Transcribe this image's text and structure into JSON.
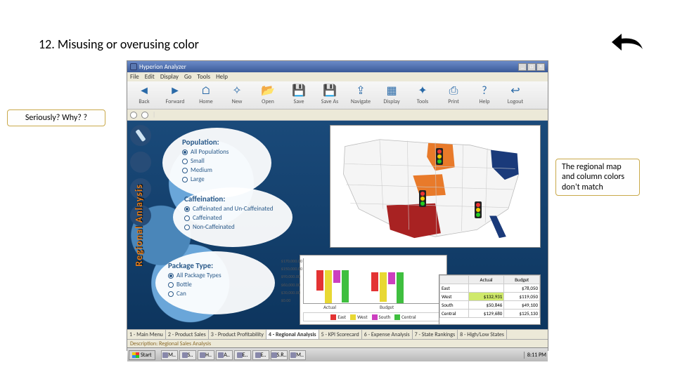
{
  "slide": {
    "title": "12.  Misusing or overusing color"
  },
  "callouts": {
    "left": "Seriously?  Why? ?",
    "right": "The regional map and column colors don't match"
  },
  "app": {
    "title": "Hyperion Analyzer",
    "menus": [
      "File",
      "Edit",
      "Display",
      "Go",
      "Tools",
      "Help"
    ],
    "toolbar": [
      {
        "label": "Back",
        "glyph": "◄"
      },
      {
        "label": "Forward",
        "glyph": "►"
      },
      {
        "label": "Home",
        "glyph": "⌂"
      },
      {
        "label": "New",
        "glyph": "✧"
      },
      {
        "label": "Open",
        "glyph": "📂"
      },
      {
        "label": "Save",
        "glyph": "💾"
      },
      {
        "label": "Save As",
        "glyph": "💾"
      },
      {
        "label": "Navigate",
        "glyph": "⇪"
      },
      {
        "label": "Display",
        "glyph": "▦"
      },
      {
        "label": "Tools",
        "glyph": "✦"
      },
      {
        "label": "Print",
        "glyph": "⎙"
      },
      {
        "label": "Help",
        "glyph": "?"
      },
      {
        "label": "Logout",
        "glyph": "↩"
      }
    ],
    "side_label": "Regional Anlaysis",
    "panels": {
      "population": {
        "title": "Population:",
        "options": [
          "All Populations",
          "Small",
          "Medium",
          "Large"
        ],
        "selected": 0
      },
      "caffeination": {
        "title": "Caffeination:",
        "options": [
          "Caffeinated and Un-Caffeinated",
          "Caffeinated",
          "Non-Caffeinated"
        ],
        "selected": 0
      },
      "package": {
        "title": "Package Type:",
        "options": [
          "All Package Types",
          "Bottle",
          "Can"
        ],
        "selected": 0
      }
    },
    "tabs": [
      "1 - Main Menu",
      "2 - Product Sales",
      "3 - Product Profitability",
      "4 - Regional Analysis",
      "5 - KPI Scorecard",
      "6 - Expense Analysis",
      "7 - State Rankings",
      "8 - High/Low States"
    ],
    "active_tab": 3,
    "description": "Description: Regional Sales Analysis",
    "taskbar": {
      "start": "Start",
      "items": [
        "M..",
        "S..",
        "H..",
        "A..",
        "E..",
        "E..",
        "S.R..",
        "M.."
      ],
      "time": "8:11 PM"
    }
  },
  "chart_data": {
    "type": "bar",
    "categories": [
      "Actual",
      "Budget"
    ],
    "series": [
      {
        "name": "East",
        "color": "#e33333",
        "values": [
          80000,
          78050
        ]
      },
      {
        "name": "West",
        "color": "#e8d833",
        "values": [
          132000,
          119050
        ]
      },
      {
        "name": "South",
        "color": "#cc3fbf",
        "values": [
          50000,
          49100
        ]
      },
      {
        "name": "Central",
        "color": "#3fbf3f",
        "values": [
          130000,
          125130
        ]
      }
    ],
    "ylim": [
      0,
      170000
    ],
    "yticks": [
      "$170,000.00",
      "$150,000.00",
      "$90,000.00",
      "$60,000.00",
      "$30,000.00",
      "$0.00"
    ],
    "legend": [
      "East",
      "West",
      "South",
      "Central"
    ]
  },
  "data_table": {
    "columns": [
      "",
      "Actual",
      "Budget"
    ],
    "rows": [
      {
        "region": "East",
        "actual": "",
        "budget": "$78,050"
      },
      {
        "region": "West",
        "actual": "$132,931",
        "budget": "$119,050",
        "hl": true
      },
      {
        "region": "South",
        "actual": "$50,846",
        "budget": "$49,100"
      },
      {
        "region": "Central",
        "actual": "$129,680",
        "budget": "$125,130"
      }
    ]
  },
  "map": {
    "highlighted_regions": [
      "northeast",
      "midwest",
      "south",
      "texas",
      "florida"
    ]
  }
}
